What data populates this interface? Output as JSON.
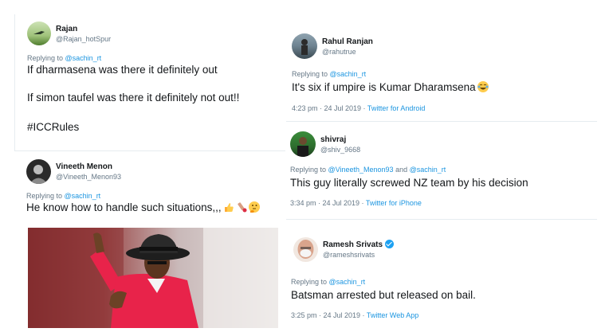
{
  "tweets": {
    "rajan": {
      "name": "Rajan",
      "handle": "@Rajan_hotSpur",
      "replying_prefix": "Replying to ",
      "replying_to": "@sachin_rt",
      "line1": "If dharmasena was there it definitely out",
      "line2": "If simon taufel was there it definitely not out!!",
      "hashtag": "#ICCRules"
    },
    "rahul": {
      "name": "Rahul Ranjan",
      "handle": "@rahutrue",
      "replying_prefix": "Replying to ",
      "replying_to": "@sachin_rt",
      "text": "It's six if umpire is Kumar Dharamsena",
      "time": "4:23 pm · 24 Jul 2019 · ",
      "source": "Twitter for Android"
    },
    "shivraj": {
      "name": "shivraj",
      "handle": "@shiv_9668",
      "replying_prefix": "Replying to ",
      "replying_to": "@Vineeth_Menon93",
      "replying_and": " and ",
      "replying_to2": "@sachin_rt",
      "text": "This guy literally screwed NZ team by his decision",
      "time": "3:34 pm · 24 Jul 2019 · ",
      "source": "Twitter for iPhone"
    },
    "vineeth": {
      "name": "Vineeth Menon",
      "handle": "@Vineeth_Menon93",
      "replying_prefix": "Replying to ",
      "replying_to": "@sachin_rt",
      "text": "He know how to handle such situations,,,"
    },
    "ramesh": {
      "name": "Ramesh Srivats",
      "handle": "@rameshsrivats",
      "replying_prefix": "Replying to ",
      "replying_to": "@sachin_rt",
      "text": "Batsman arrested but released on bail.",
      "time": "3:25 pm · 24 Jul 2019 · ",
      "source": "Twitter Web App"
    }
  },
  "icons": [
    "verified-badge-icon",
    "laughing-emoji-icon",
    "thumbs-up-emoji-icon",
    "cricket-bat-emoji-icon",
    "thinking-emoji-icon"
  ],
  "colors": {
    "link": "#1b95e0",
    "muted": "#657786",
    "text": "#14171a",
    "umpire_shirt": "#e8234a"
  }
}
